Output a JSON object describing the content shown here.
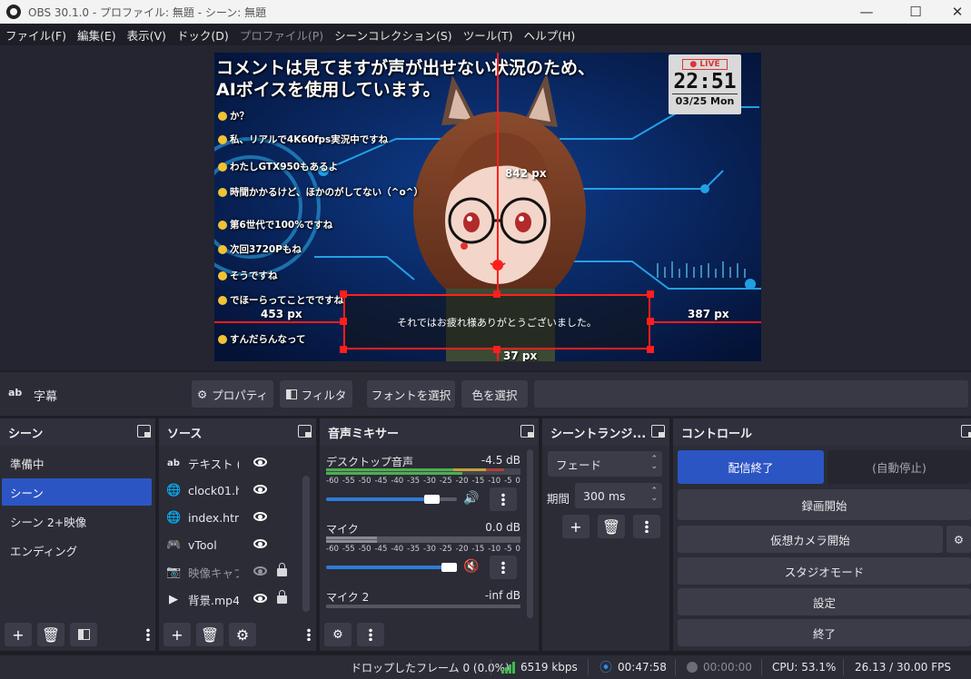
{
  "window": {
    "title": "OBS 30.1.0 - プロファイル: 無題 - シーン: 無題"
  },
  "menu": [
    {
      "label": "ファイル(F)",
      "enabled": true
    },
    {
      "label": "編集(E)",
      "enabled": true
    },
    {
      "label": "表示(V)",
      "enabled": true
    },
    {
      "label": "ドック(D)",
      "enabled": true
    },
    {
      "label": "プロファイル(P)",
      "enabled": false
    },
    {
      "label": "シーンコレクション(S)",
      "enabled": true
    },
    {
      "label": "ツール(T)",
      "enabled": true
    },
    {
      "label": "ヘルプ(H)",
      "enabled": true
    }
  ],
  "preview": {
    "overlay_line1": "コメントは見てますが声が出せない状況のため、",
    "overlay_line2": "AIボイスを使用しています。",
    "comments": [
      "か？",
      "私、リアルで4K60fps実況中ですね",
      "わたしGTX950もあるよ",
      "時間かかるけど、ほかのがしてない（^o^）",
      "第6世代で100%ですね",
      "次回3720Pもね",
      "そうですね",
      "でほーらってことでですね",
      "すんだらんなって"
    ],
    "clock": {
      "live": "● LIVE",
      "time": "22:51",
      "date": "03/25 Mon"
    },
    "subtitle_text": "それではお疲れ様ありがとうございました。",
    "guides": {
      "top": "842 px",
      "left": "453 px",
      "right": "387 px",
      "bottom": "37 px"
    }
  },
  "source_toolbar": {
    "source_name": "字幕",
    "properties": "プロパティ",
    "filters": "フィルタ",
    "select_font": "フォントを選択",
    "select_color": "色を選択"
  },
  "scenes": {
    "title": "シーン",
    "items": [
      {
        "label": "準備中",
        "selected": false
      },
      {
        "label": "シーン",
        "selected": true
      },
      {
        "label": "シーン 2+映像",
        "selected": false
      },
      {
        "label": "エンディング",
        "selected": false
      }
    ]
  },
  "sources": {
    "title": "ソース",
    "items": [
      {
        "icon": "text-icon",
        "label": "テキスト (G",
        "visible": true,
        "locked": false
      },
      {
        "icon": "browser-icon",
        "label": "clock01.h",
        "visible": true,
        "locked": false
      },
      {
        "icon": "browser-icon",
        "label": "index.htn",
        "visible": true,
        "locked": false
      },
      {
        "icon": "gamepad-icon",
        "label": "vTool",
        "visible": true,
        "locked": false
      },
      {
        "icon": "camera-icon",
        "label": "映像キャブ",
        "visible": false,
        "locked": true
      },
      {
        "icon": "media-icon",
        "label": "背景.mp4",
        "visible": true,
        "locked": true
      }
    ]
  },
  "mixer": {
    "title": "音声ミキサー",
    "scale": [
      "-60",
      "-55",
      "-50",
      "-45",
      "-40",
      "-35",
      "-30",
      "-25",
      "-20",
      "-15",
      "-10",
      "-5",
      "0"
    ],
    "channels": [
      {
        "name": "デスクトップ音声",
        "db": "-4.5 dB",
        "volume": 0.78,
        "muted": false,
        "level": 0.92
      },
      {
        "name": "マイク",
        "db": "0.0 dB",
        "volume": 1.0,
        "muted": true,
        "level": 0.0
      },
      {
        "name": "マイク 2",
        "db": "-inf dB",
        "volume": 1.0,
        "muted": false,
        "level": 0.0
      }
    ]
  },
  "transitions": {
    "title": "シーントランジ...",
    "selected": "フェード",
    "duration_label": "期間",
    "duration": "300 ms"
  },
  "controls": {
    "title": "コントロール",
    "stop_stream": "配信終了",
    "auto_stop": "(自動停止)",
    "start_recording": "録画開始",
    "start_virtual_cam": "仮想カメラ開始",
    "studio_mode": "スタジオモード",
    "settings": "設定",
    "exit": "終了"
  },
  "status": {
    "dropped_frames": "ドロップしたフレーム 0 (0.0%)",
    "bitrate": "6519 kbps",
    "stream_time": "00:47:58",
    "record_time": "00:00:00",
    "cpu": "CPU: 53.1%",
    "fps": "26.13 / 30.00 FPS"
  },
  "colors": {
    "accent": "#2c55c4",
    "guide": "#ff1e1e",
    "stream_active": "#2f8ee8",
    "bitrate_ok": "#3fb950"
  }
}
